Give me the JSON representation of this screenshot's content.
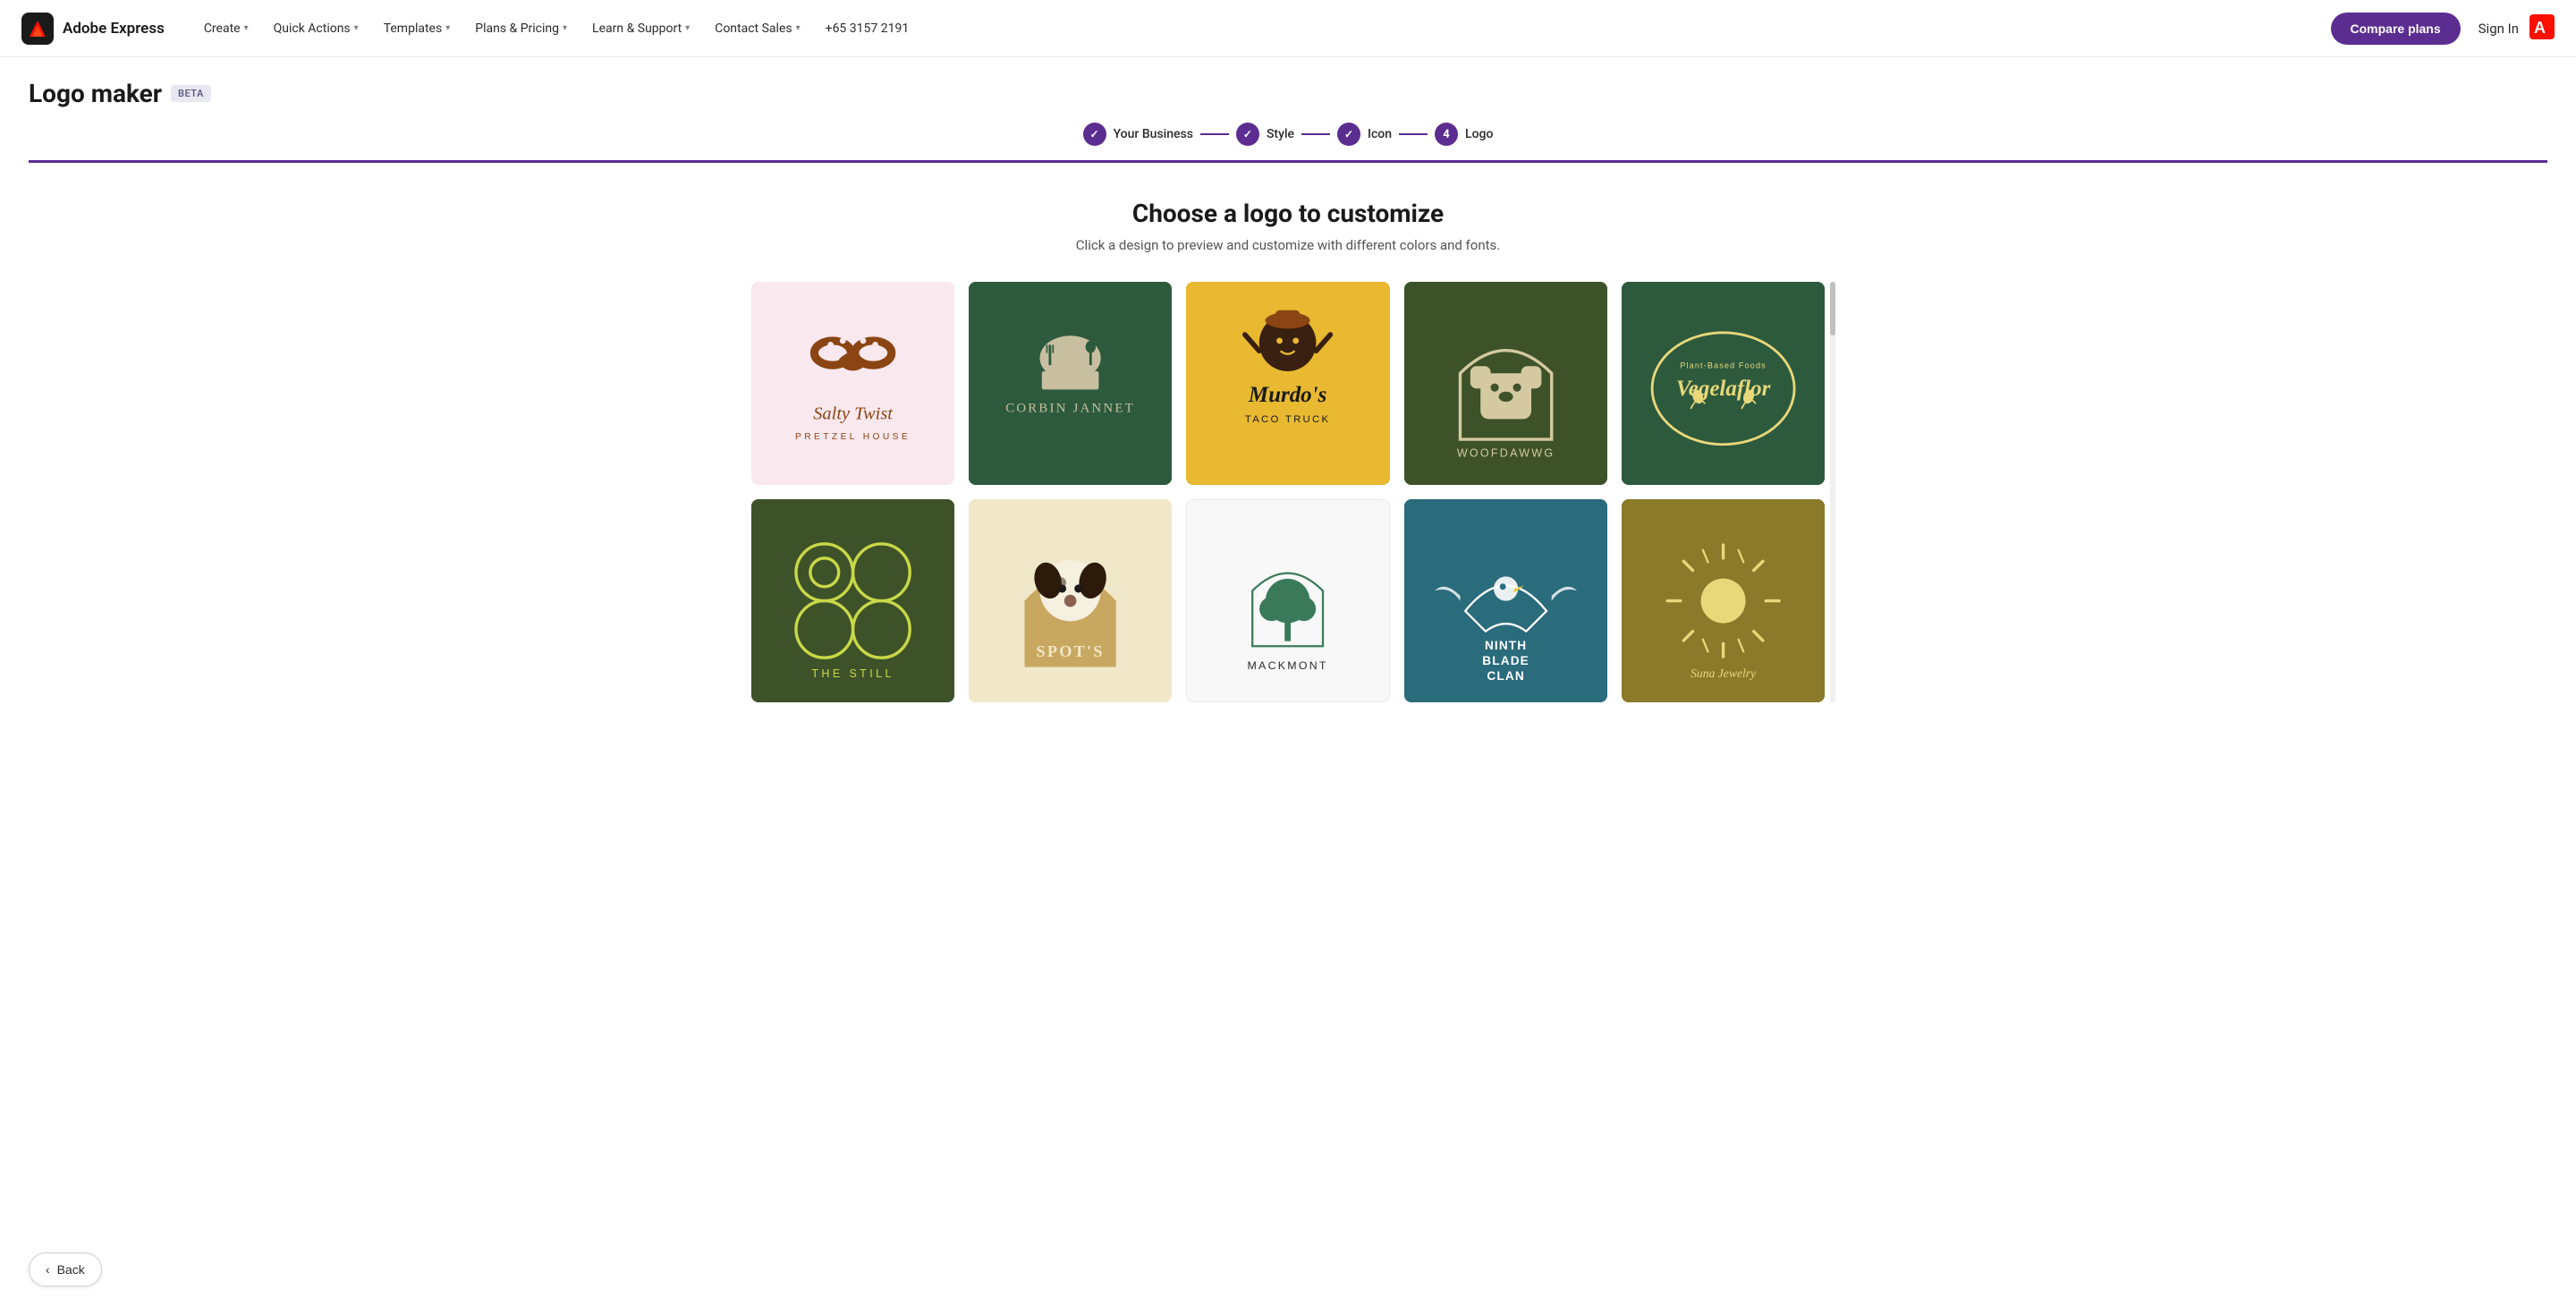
{
  "brand": {
    "name": "Adobe Express"
  },
  "nav": {
    "items": [
      {
        "label": "Create",
        "has_dropdown": true
      },
      {
        "label": "Quick Actions",
        "has_dropdown": true
      },
      {
        "label": "Templates",
        "has_dropdown": true
      },
      {
        "label": "Plans & Pricing",
        "has_dropdown": true
      },
      {
        "label": "Learn & Support",
        "has_dropdown": true
      },
      {
        "label": "Contact Sales",
        "has_dropdown": true
      }
    ],
    "phone": "+65 3157 2191",
    "compare_btn": "Compare plans",
    "sign_in": "Sign In"
  },
  "page": {
    "title": "Logo maker",
    "beta_label": "BETA"
  },
  "steps": [
    {
      "label": "Your Business",
      "state": "done",
      "icon": "✓"
    },
    {
      "label": "Style",
      "state": "done",
      "icon": "✓"
    },
    {
      "label": "Icon",
      "state": "done",
      "icon": "✓"
    },
    {
      "label": "Logo",
      "state": "current",
      "number": "4"
    }
  ],
  "main": {
    "title": "Choose a logo to customize",
    "subtitle": "Click a design to preview and customize with different colors and fonts."
  },
  "logos": [
    {
      "id": "salty-twist",
      "name": "Salty Twist",
      "subtitle": "PRETZEL HOUSE",
      "bg": "#f9e8ee",
      "text_color": "#8b4513",
      "card_class": "card-salty"
    },
    {
      "id": "corbin-jannet",
      "name": "CORBIN JANNET",
      "subtitle": "",
      "bg": "#2d5a3d",
      "text_color": "#d4c9a8",
      "card_class": "card-corbin"
    },
    {
      "id": "murdos",
      "name": "Murdo's",
      "subtitle": "TACO TRUCK",
      "bg": "#e8b931",
      "text_color": "#1a1a1a",
      "card_class": "card-murdos"
    },
    {
      "id": "woofdawwg",
      "name": "WOOFDAWWG",
      "subtitle": "",
      "bg": "#3d5229",
      "text_color": "#fff",
      "card_class": "card-woofdawwg"
    },
    {
      "id": "vegelaflor",
      "name": "Vegelaflor",
      "subtitle": "Plant-Based Foods",
      "bg": "#2d5a3d",
      "text_color": "#e8d87a",
      "card_class": "card-vegelaflor"
    },
    {
      "id": "the-still",
      "name": "THE STILL",
      "subtitle": "",
      "bg": "#3d5229",
      "text_color": "#c8d848",
      "card_class": "card-thestill"
    },
    {
      "id": "spots",
      "name": "SPOT'S",
      "subtitle": "",
      "bg": "#f0e8c8",
      "text_color": "#3d2a1a",
      "card_class": "card-spots"
    },
    {
      "id": "mackmont",
      "name": "MACKMONT",
      "subtitle": "",
      "bg": "#f8f8f8",
      "text_color": "#2c2c2c",
      "card_class": "card-mackmont"
    },
    {
      "id": "ninth-blade-clan",
      "name": "NINTH BLADE CLAN",
      "subtitle": "",
      "bg": "#2a6b7c",
      "text_color": "#fff",
      "card_class": "card-ninthblade"
    },
    {
      "id": "sun",
      "name": "Suna Jewelry",
      "subtitle": "",
      "bg": "#8a7a2a",
      "text_color": "#e8d87a",
      "card_class": "card-sun"
    }
  ],
  "back_button": "Back"
}
